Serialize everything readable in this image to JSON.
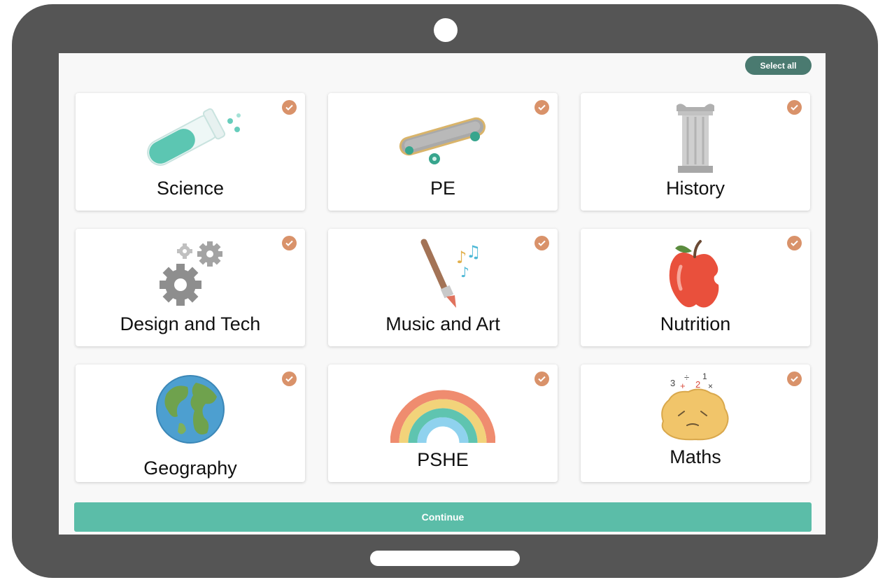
{
  "toolbar": {
    "select_all_label": "Select all"
  },
  "subjects": [
    {
      "label": "Science",
      "icon": "test-tube-icon",
      "selected": true
    },
    {
      "label": "PE",
      "icon": "skateboard-icon",
      "selected": true
    },
    {
      "label": "History",
      "icon": "column-icon",
      "selected": true
    },
    {
      "label": "Design and Tech",
      "icon": "gears-icon",
      "selected": true
    },
    {
      "label": "Music and Art",
      "icon": "paintbrush-music-icon",
      "selected": true
    },
    {
      "label": "Nutrition",
      "icon": "apple-icon",
      "selected": true
    },
    {
      "label": "Geography",
      "icon": "globe-icon",
      "selected": true
    },
    {
      "label": "PSHE",
      "icon": "rainbow-icon",
      "selected": true
    },
    {
      "label": "Maths",
      "icon": "maths-rock-icon",
      "selected": true
    }
  ],
  "math_symbols": [
    "3",
    "÷",
    "1",
    "+",
    "2",
    "×"
  ],
  "footer": {
    "continue_label": "Continue"
  },
  "colors": {
    "accent": "#5bbda8",
    "select_all_bg": "#4a7a70",
    "check": "#d9926a",
    "device": "#555555"
  }
}
